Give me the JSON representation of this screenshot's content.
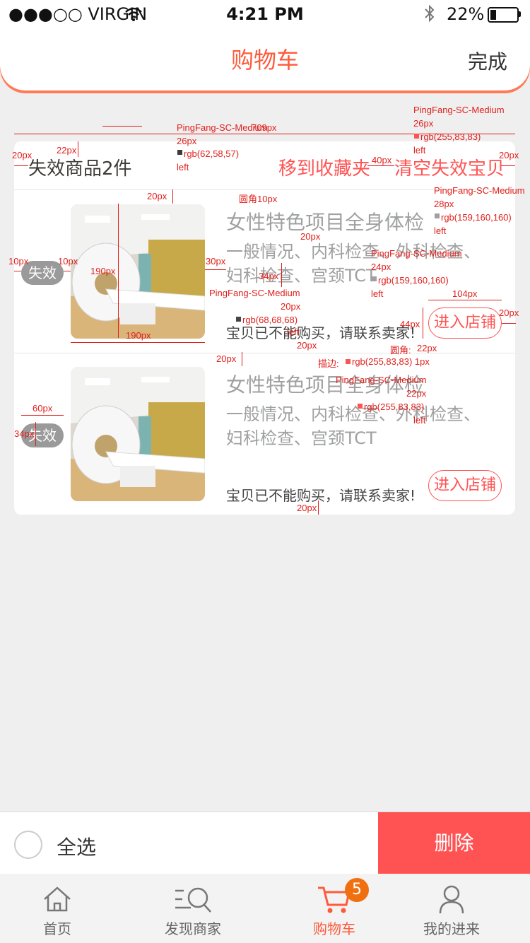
{
  "status_bar": {
    "carrier": "●●●○○ VIRGIN",
    "time": "4:21 PM",
    "battery": "22%"
  },
  "nav": {
    "title": "购物车",
    "done": "完成"
  },
  "card": {
    "count_label": "失效商品2件",
    "move_to_fav": "移到收藏夹",
    "clear_invalid": "清空失效宝贝",
    "items": [
      {
        "badge": "失效",
        "name": "女性特色项目全身体检",
        "desc": "一般情况、内科检查、外科检查、妇科检查、宫颈TCT",
        "warning": "宝贝已不能购买，请联系卖家!",
        "shop_button": "进入店铺"
      },
      {
        "badge": "失效",
        "name": "女性特色项目全身体检",
        "desc": "一般情况、内科检查、外科检查、妇科检查、宫颈TCT",
        "warning": "宝贝已不能购买，请联系卖家!",
        "shop_button": "进入店铺"
      }
    ]
  },
  "annotations": {
    "a1": "PingFang-SC-Medium",
    "a2": "26px",
    "a3": "rgb(62,58,57)",
    "a4": "left",
    "a5": "PingFang-SC-Medium",
    "a6": "26px",
    "a7": "rgb(255,83,83)",
    "a8": "left",
    "a9": "PingFang-SC-Medium",
    "a10": "28px",
    "a11": "rgb(159,160,160)",
    "a12": "left",
    "a13": "PingFang-SC-Medium",
    "a14": "24px",
    "a15": "rgb(159,160,160)",
    "a16": "left",
    "a17": "PingFang-SC-Medium",
    "a18": "20px",
    "a19": "rgb(68,68,68)",
    "a20": "left",
    "a21": "PingFang-SC-Medium",
    "a22": "22px",
    "a23": "rgb(255,83,83)",
    "a24": "left",
    "stroke": "描边: ",
    "stroke_val": "rgb(255,83,83) 1px",
    "radius": "圆角: ",
    "radius_val": "22px",
    "corner": "圆角10px",
    "d709": "709px",
    "d20a": "20px",
    "d20b": "20px",
    "d22": "22px",
    "d40": "40px",
    "d20c": "20px",
    "d10a": "10px",
    "d10b": "10px",
    "d190a": "190px",
    "d190b": "190px",
    "d30": "30px",
    "d20d": "20px",
    "d34a": "34px",
    "d44": "44px",
    "d104": "104px",
    "d20e": "20px",
    "d20f": "20px",
    "d20g": "20px",
    "d60": "60px",
    "d34b": "34px",
    "d20h": "20px",
    "d20i": "20px"
  },
  "action_bar": {
    "select_all": "全选",
    "delete": "删除"
  },
  "tabbar": {
    "items": [
      {
        "label": "首页",
        "icon": "home-icon"
      },
      {
        "label": "发现商家",
        "icon": "discover-icon"
      },
      {
        "label": "购物车",
        "icon": "cart-icon",
        "active": true
      },
      {
        "label": "我的进来",
        "icon": "profile-icon"
      }
    ],
    "cart_badge": "5"
  },
  "colors": {
    "accent": "#ff5353",
    "title": "#ff5a3c",
    "muted_text": "#9fa0a0",
    "badge": "#f0700f"
  }
}
